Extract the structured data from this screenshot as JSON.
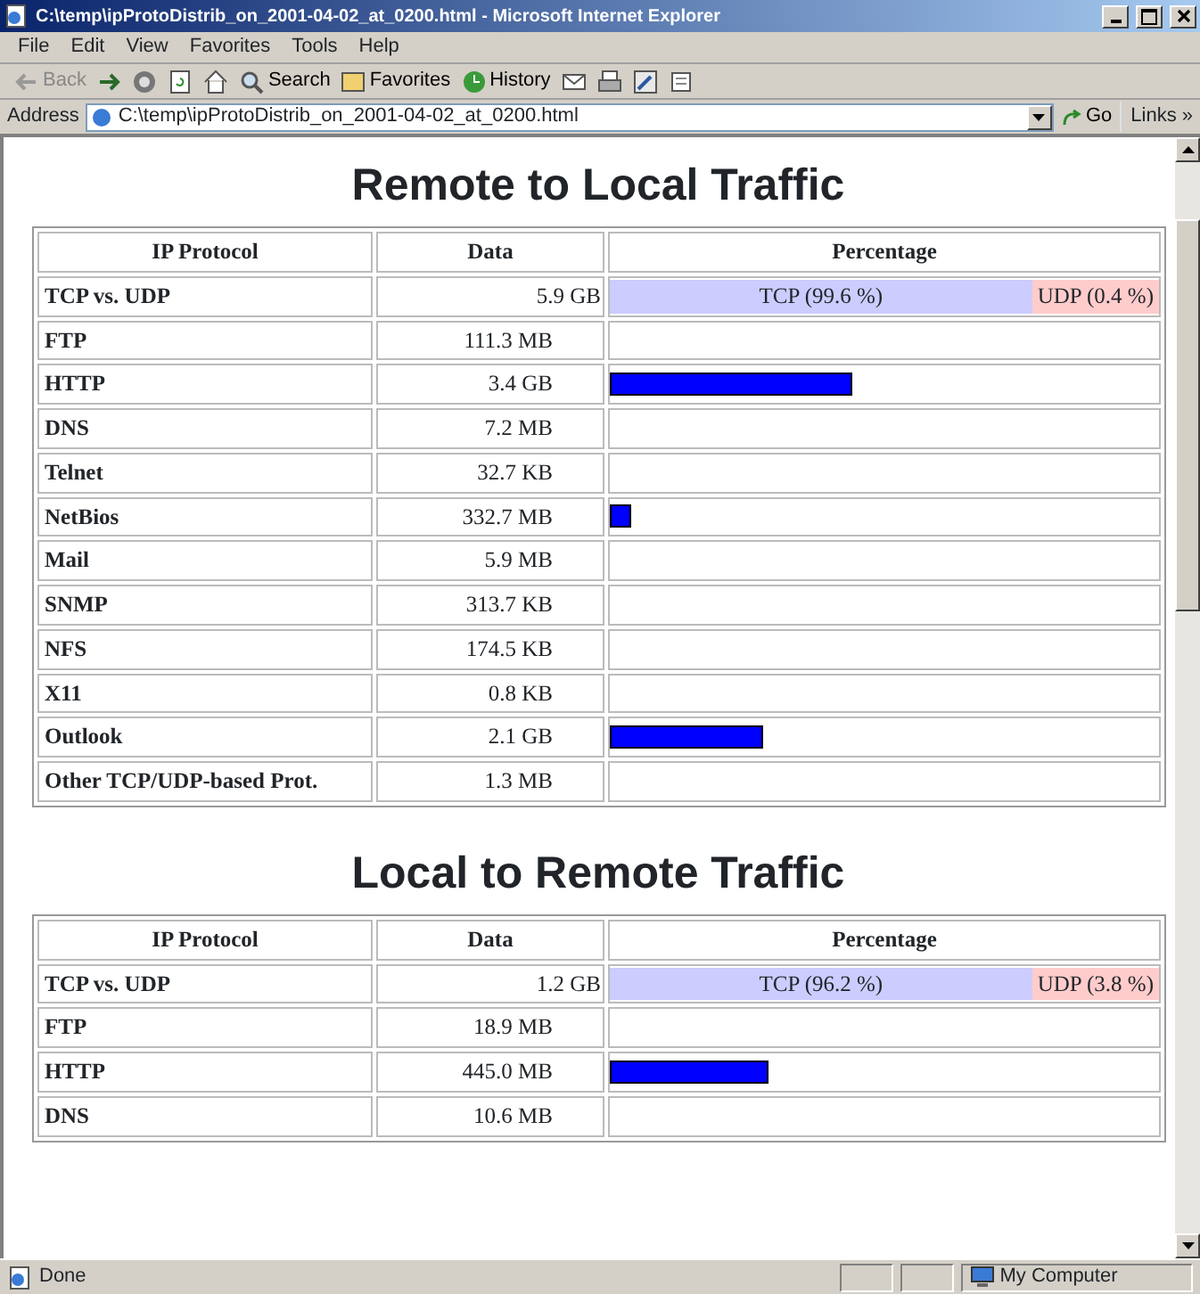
{
  "window": {
    "title": "C:\\temp\\ipProtoDistrib_on_2001-04-02_at_0200.html - Microsoft Internet Explorer"
  },
  "menu": [
    "File",
    "Edit",
    "View",
    "Favorites",
    "Tools",
    "Help"
  ],
  "toolbar": [
    {
      "kind": "back",
      "label": "Back",
      "disabled": true
    },
    {
      "kind": "forward",
      "disabled": false
    },
    {
      "kind": "stop"
    },
    {
      "kind": "refresh"
    },
    {
      "kind": "home"
    },
    {
      "kind": "search",
      "label": "Search"
    },
    {
      "kind": "favorites",
      "label": "Favorites"
    },
    {
      "kind": "history",
      "label": "History"
    },
    {
      "kind": "mail"
    },
    {
      "kind": "print"
    },
    {
      "kind": "edit"
    },
    {
      "kind": "discuss"
    }
  ],
  "address_bar": {
    "label": "Address",
    "value": "C:\\temp\\ipProtoDistrib_on_2001-04-02_at_0200.html",
    "go": "Go",
    "links": "Links »"
  },
  "sections": [
    {
      "heading": "Remote to Local Traffic",
      "columns": [
        "IP Protocol",
        "Data",
        "Percentage"
      ],
      "rows": [
        {
          "kind": "split",
          "protocol": "TCP vs. UDP",
          "data": "5.9 GB",
          "tcp": "TCP (99.6 %)",
          "udp": "UDP (0.4 %)"
        },
        {
          "kind": "bar",
          "protocol": "FTP",
          "data": "111.3 MB"
        },
        {
          "kind": "bar",
          "protocol": "HTTP",
          "data": "3.4 GB",
          "level": 0.44
        },
        {
          "kind": "bar",
          "protocol": "DNS",
          "data": "7.2 MB"
        },
        {
          "kind": "bar",
          "protocol": "Telnet",
          "data": "32.7 KB"
        },
        {
          "kind": "bar",
          "protocol": "NetBios",
          "data": "332.7 MB",
          "level": 0.04
        },
        {
          "kind": "bar",
          "protocol": "Mail",
          "data": "5.9 MB"
        },
        {
          "kind": "bar",
          "protocol": "SNMP",
          "data": "313.7 KB"
        },
        {
          "kind": "bar",
          "protocol": "NFS",
          "data": "174.5 KB"
        },
        {
          "kind": "bar",
          "protocol": "X11",
          "data": "0.8 KB"
        },
        {
          "kind": "bar",
          "protocol": "Outlook",
          "data": "2.1 GB",
          "level": 0.28
        },
        {
          "kind": "bar",
          "protocol": "Other TCP/UDP-based Prot.",
          "data": "1.3 MB"
        }
      ]
    },
    {
      "heading": "Local to Remote Traffic",
      "columns": [
        "IP Protocol",
        "Data",
        "Percentage"
      ],
      "rows": [
        {
          "kind": "split",
          "protocol": "TCP vs. UDP",
          "data": "1.2 GB",
          "tcp": "TCP (96.2 %)",
          "udp": "UDP (3.8 %)"
        },
        {
          "kind": "bar",
          "protocol": "FTP",
          "data": "18.9 MB"
        },
        {
          "kind": "bar",
          "protocol": "HTTP",
          "data": "445.0 MB",
          "level": 0.29
        },
        {
          "kind": "bar",
          "protocol": "DNS",
          "data": "10.6 MB"
        }
      ]
    }
  ],
  "status_bar": {
    "status": "Done",
    "zone": "My Computer"
  }
}
